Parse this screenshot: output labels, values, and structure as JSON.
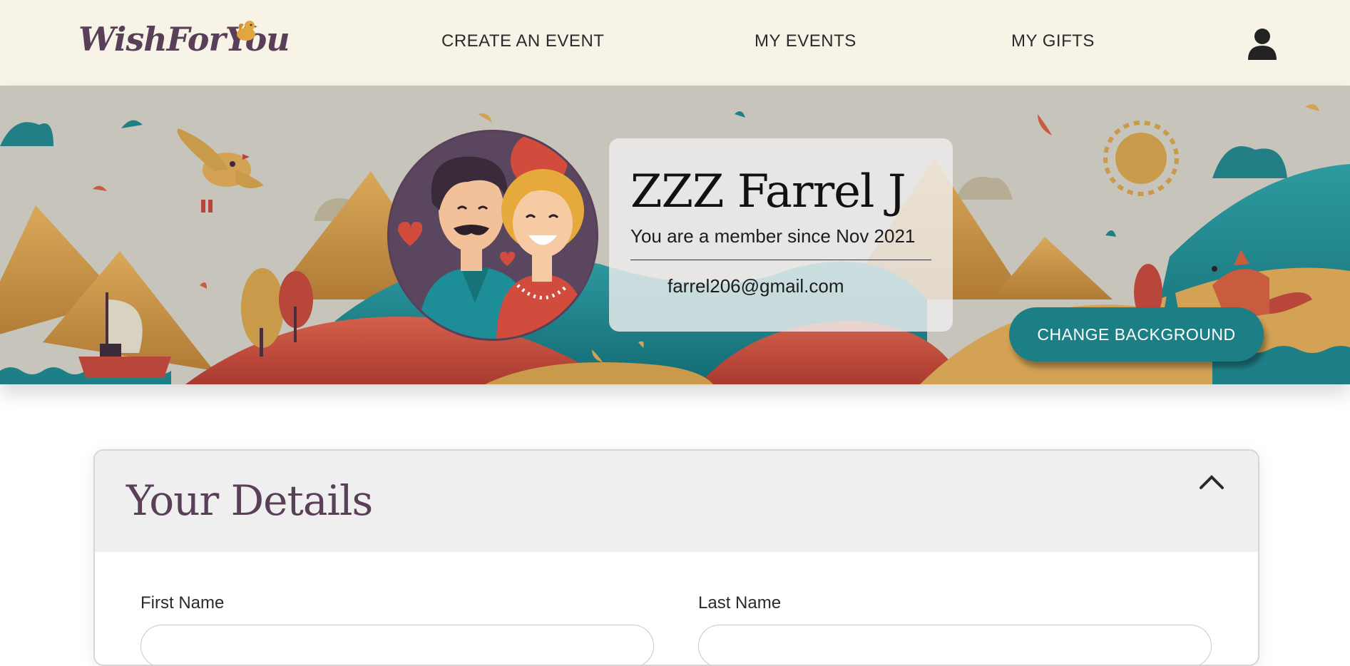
{
  "header": {
    "logo_text": "WishForYou",
    "nav": [
      {
        "label": "CREATE AN EVENT"
      },
      {
        "label": "MY EVENTS"
      },
      {
        "label": "MY GIFTS"
      }
    ],
    "user_icon": "user-icon"
  },
  "banner": {
    "profile": {
      "name": "ZZZ Farrel J",
      "member_since": "You are a member since Nov 2021",
      "email": "farrel206@gmail.com"
    },
    "change_background_label": "CHANGE BACKGROUND"
  },
  "details": {
    "title": "Your Details",
    "expanded": true,
    "fields": {
      "first_name_label": "First Name",
      "first_name_value": "",
      "last_name_label": "Last Name",
      "last_name_value": ""
    }
  },
  "colors": {
    "header_bg": "#f7f4e7",
    "brand_purple": "#5a3f58",
    "accent_teal": "#1c7f86",
    "banner_bg": "#c7c4bb",
    "mustard": "#c99a4a",
    "terracotta": "#b9463a"
  }
}
